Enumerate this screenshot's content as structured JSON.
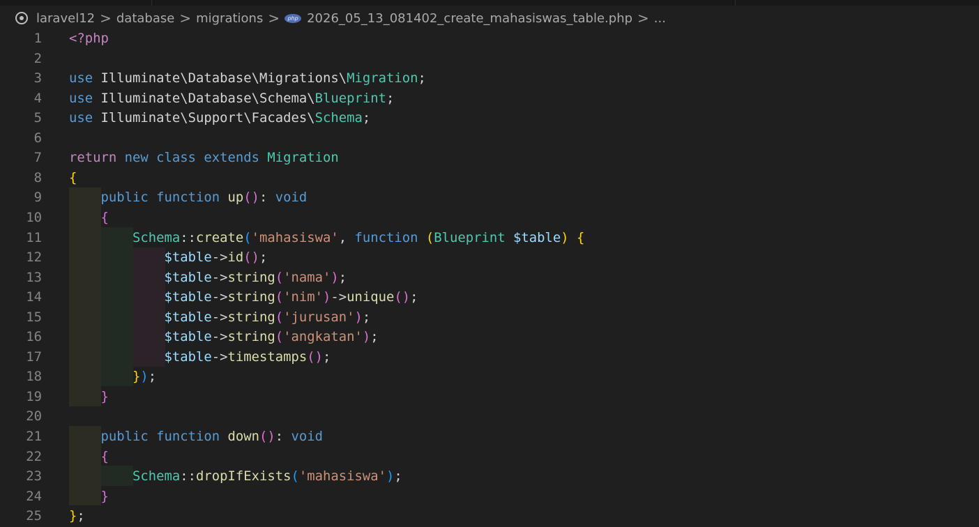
{
  "breadcrumb": {
    "items": [
      "laravel12",
      "database",
      "migrations",
      "2026_05_13_081402_create_mahasiswas_table.php",
      "..."
    ],
    "file_icon_label": "php",
    "separator": ">"
  },
  "editor": {
    "language": "php",
    "lines": [
      {
        "n": "1",
        "tokens": [
          [
            "ctl",
            "<?php"
          ]
        ]
      },
      {
        "n": "2",
        "tokens": []
      },
      {
        "n": "3",
        "tokens": [
          [
            "kw",
            "use"
          ],
          [
            "pl",
            " Illuminate\\Database\\Migrations\\"
          ],
          [
            "typ",
            "Migration"
          ],
          [
            "pl",
            ";"
          ]
        ]
      },
      {
        "n": "4",
        "tokens": [
          [
            "kw",
            "use"
          ],
          [
            "pl",
            " Illuminate\\Database\\Schema\\"
          ],
          [
            "typ",
            "Blueprint"
          ],
          [
            "pl",
            ";"
          ]
        ]
      },
      {
        "n": "5",
        "tokens": [
          [
            "kw",
            "use"
          ],
          [
            "pl",
            " Illuminate\\Support\\Facades\\"
          ],
          [
            "typ",
            "Schema"
          ],
          [
            "pl",
            ";"
          ]
        ]
      },
      {
        "n": "6",
        "tokens": []
      },
      {
        "n": "7",
        "tokens": [
          [
            "ctl",
            "return"
          ],
          [
            "pl",
            " "
          ],
          [
            "kw",
            "new"
          ],
          [
            "pl",
            " "
          ],
          [
            "kw",
            "class"
          ],
          [
            "pl",
            " "
          ],
          [
            "kw",
            "extends"
          ],
          [
            "pl",
            " "
          ],
          [
            "typ",
            "Migration"
          ]
        ]
      },
      {
        "n": "8",
        "tokens": [
          [
            "b1",
            "{"
          ]
        ]
      },
      {
        "n": "9",
        "tokens": [
          [
            "pl",
            "    "
          ],
          [
            "kw",
            "public"
          ],
          [
            "pl",
            " "
          ],
          [
            "kw",
            "function"
          ],
          [
            "pl",
            " "
          ],
          [
            "fn",
            "up"
          ],
          [
            "b2",
            "()"
          ],
          [
            "pl",
            ": "
          ],
          [
            "kw",
            "void"
          ]
        ]
      },
      {
        "n": "10",
        "tokens": [
          [
            "pl",
            "    "
          ],
          [
            "b2",
            "{"
          ]
        ]
      },
      {
        "n": "11",
        "tokens": [
          [
            "pl",
            "        "
          ],
          [
            "typ",
            "Schema"
          ],
          [
            "pl",
            "::"
          ],
          [
            "fn",
            "create"
          ],
          [
            "b3",
            "("
          ],
          [
            "str",
            "'mahasiswa'"
          ],
          [
            "pl",
            ", "
          ],
          [
            "kw",
            "function"
          ],
          [
            "pl",
            " "
          ],
          [
            "b1",
            "("
          ],
          [
            "typ",
            "Blueprint"
          ],
          [
            "pl",
            " "
          ],
          [
            "var",
            "$table"
          ],
          [
            "b1",
            ")"
          ],
          [
            "pl",
            " "
          ],
          [
            "b1",
            "{"
          ]
        ]
      },
      {
        "n": "12",
        "tokens": [
          [
            "pl",
            "            "
          ],
          [
            "var",
            "$table"
          ],
          [
            "pl",
            "->"
          ],
          [
            "fn",
            "id"
          ],
          [
            "b2",
            "()"
          ],
          [
            "pl",
            ";"
          ]
        ]
      },
      {
        "n": "13",
        "tokens": [
          [
            "pl",
            "            "
          ],
          [
            "var",
            "$table"
          ],
          [
            "pl",
            "->"
          ],
          [
            "fn",
            "string"
          ],
          [
            "b2",
            "("
          ],
          [
            "str",
            "'nama'"
          ],
          [
            "b2",
            ")"
          ],
          [
            "pl",
            ";"
          ]
        ]
      },
      {
        "n": "14",
        "tokens": [
          [
            "pl",
            "            "
          ],
          [
            "var",
            "$table"
          ],
          [
            "pl",
            "->"
          ],
          [
            "fn",
            "string"
          ],
          [
            "b2",
            "("
          ],
          [
            "str",
            "'nim'"
          ],
          [
            "b2",
            ")"
          ],
          [
            "pl",
            "->"
          ],
          [
            "fn",
            "unique"
          ],
          [
            "b2",
            "()"
          ],
          [
            "pl",
            ";"
          ]
        ]
      },
      {
        "n": "15",
        "tokens": [
          [
            "pl",
            "            "
          ],
          [
            "var",
            "$table"
          ],
          [
            "pl",
            "->"
          ],
          [
            "fn",
            "string"
          ],
          [
            "b2",
            "("
          ],
          [
            "str",
            "'jurusan'"
          ],
          [
            "b2",
            ")"
          ],
          [
            "pl",
            ";"
          ]
        ]
      },
      {
        "n": "16",
        "tokens": [
          [
            "pl",
            "            "
          ],
          [
            "var",
            "$table"
          ],
          [
            "pl",
            "->"
          ],
          [
            "fn",
            "string"
          ],
          [
            "b2",
            "("
          ],
          [
            "str",
            "'angkatan'"
          ],
          [
            "b2",
            ")"
          ],
          [
            "pl",
            ";"
          ]
        ]
      },
      {
        "n": "17",
        "tokens": [
          [
            "pl",
            "            "
          ],
          [
            "var",
            "$table"
          ],
          [
            "pl",
            "->"
          ],
          [
            "fn",
            "timestamps"
          ],
          [
            "b2",
            "()"
          ],
          [
            "pl",
            ";"
          ]
        ]
      },
      {
        "n": "18",
        "tokens": [
          [
            "pl",
            "        "
          ],
          [
            "b1",
            "}"
          ],
          [
            "b3",
            ")"
          ],
          [
            "pl",
            ";"
          ]
        ]
      },
      {
        "n": "19",
        "tokens": [
          [
            "pl",
            "    "
          ],
          [
            "b2",
            "}"
          ]
        ]
      },
      {
        "n": "20",
        "tokens": []
      },
      {
        "n": "21",
        "tokens": [
          [
            "pl",
            "    "
          ],
          [
            "kw",
            "public"
          ],
          [
            "pl",
            " "
          ],
          [
            "kw",
            "function"
          ],
          [
            "pl",
            " "
          ],
          [
            "fn",
            "down"
          ],
          [
            "b2",
            "()"
          ],
          [
            "pl",
            ": "
          ],
          [
            "kw",
            "void"
          ]
        ]
      },
      {
        "n": "22",
        "tokens": [
          [
            "pl",
            "    "
          ],
          [
            "b2",
            "{"
          ]
        ]
      },
      {
        "n": "23",
        "tokens": [
          [
            "pl",
            "        "
          ],
          [
            "typ",
            "Schema"
          ],
          [
            "pl",
            "::"
          ],
          [
            "fn",
            "dropIfExists"
          ],
          [
            "b3",
            "("
          ],
          [
            "str",
            "'mahasiswa'"
          ],
          [
            "b3",
            ")"
          ],
          [
            "pl",
            ";"
          ]
        ]
      },
      {
        "n": "24",
        "tokens": [
          [
            "pl",
            "    "
          ],
          [
            "b2",
            "}"
          ]
        ]
      },
      {
        "n": "25",
        "tokens": [
          [
            "b1",
            "}"
          ],
          [
            "pl",
            ";"
          ]
        ]
      }
    ]
  }
}
